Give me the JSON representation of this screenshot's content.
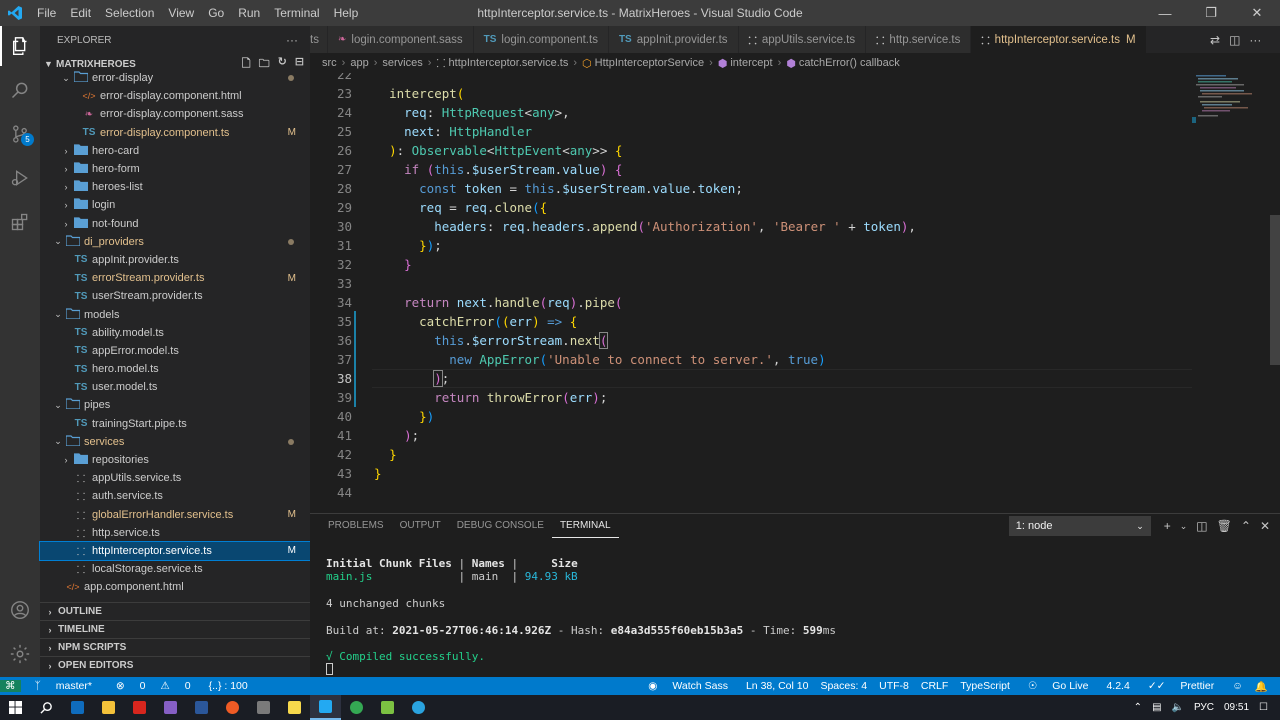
{
  "titlebar": {
    "menu": [
      "File",
      "Edit",
      "Selection",
      "View",
      "Go",
      "Run",
      "Terminal",
      "Help"
    ],
    "title": "httpInterceptor.service.ts - MatrixHeroes - Visual Studio Code"
  },
  "activitybar": {
    "scm_badge": "5"
  },
  "sidebar": {
    "header": "EXPLORER",
    "project": "MATRIXHEROES",
    "tree": [
      {
        "label": "error-display",
        "kind": "folder",
        "depth": 2,
        "open": true,
        "dot": true
      },
      {
        "label": "error-display.component.html",
        "kind": "html",
        "depth": 3
      },
      {
        "label": "error-display.component.sass",
        "kind": "sass",
        "depth": 3
      },
      {
        "label": "error-display.component.ts",
        "kind": "ts",
        "depth": 3,
        "status": "M"
      },
      {
        "label": "hero-card",
        "kind": "folder",
        "depth": 2,
        "open": false
      },
      {
        "label": "hero-form",
        "kind": "folder",
        "depth": 2,
        "open": false
      },
      {
        "label": "heroes-list",
        "kind": "folder",
        "depth": 2,
        "open": false
      },
      {
        "label": "login",
        "kind": "folder",
        "depth": 2,
        "open": false
      },
      {
        "label": "not-found",
        "kind": "folder",
        "depth": 2,
        "open": false
      },
      {
        "label": "di_providers",
        "kind": "folder",
        "depth": 1,
        "open": true,
        "dot": true,
        "mod": true
      },
      {
        "label": "appInit.provider.ts",
        "kind": "ts",
        "depth": 2
      },
      {
        "label": "errorStream.provider.ts",
        "kind": "ts",
        "depth": 2,
        "status": "M"
      },
      {
        "label": "userStream.provider.ts",
        "kind": "ts",
        "depth": 2
      },
      {
        "label": "models",
        "kind": "folder",
        "depth": 1,
        "open": true
      },
      {
        "label": "ability.model.ts",
        "kind": "ts",
        "depth": 2
      },
      {
        "label": "appError.model.ts",
        "kind": "ts",
        "depth": 2
      },
      {
        "label": "hero.model.ts",
        "kind": "ts",
        "depth": 2
      },
      {
        "label": "user.model.ts",
        "kind": "ts",
        "depth": 2
      },
      {
        "label": "pipes",
        "kind": "folder",
        "depth": 1,
        "open": true
      },
      {
        "label": "trainingStart.pipe.ts",
        "kind": "ts",
        "depth": 2
      },
      {
        "label": "services",
        "kind": "folder",
        "depth": 1,
        "open": true,
        "dot": true,
        "mod": true
      },
      {
        "label": "repositories",
        "kind": "folder",
        "depth": 2,
        "open": false
      },
      {
        "label": "appUtils.service.ts",
        "kind": "ng",
        "depth": 2
      },
      {
        "label": "auth.service.ts",
        "kind": "ng",
        "depth": 2
      },
      {
        "label": "globalErrorHandler.service.ts",
        "kind": "ng",
        "depth": 2,
        "status": "M"
      },
      {
        "label": "http.service.ts",
        "kind": "ng",
        "depth": 2
      },
      {
        "label": "httpInterceptor.service.ts",
        "kind": "ng",
        "depth": 2,
        "status": "M",
        "selected": true
      },
      {
        "label": "localStorage.service.ts",
        "kind": "ng",
        "depth": 2
      },
      {
        "label": "app.component.html",
        "kind": "html",
        "depth": 1
      }
    ],
    "sections": [
      "OUTLINE",
      "TIMELINE",
      "NPM SCRIPTS",
      "OPEN EDITORS"
    ]
  },
  "tabs": [
    {
      "label": "ts",
      "icon": "",
      "partial": true
    },
    {
      "label": "login.component.sass",
      "icon": "sass"
    },
    {
      "label": "login.component.ts",
      "icon": "TS"
    },
    {
      "label": "appInit.provider.ts",
      "icon": "TS"
    },
    {
      "label": "appUtils.service.ts",
      "icon": "ng"
    },
    {
      "label": "http.service.ts",
      "icon": "ng"
    },
    {
      "label": "httpInterceptor.service.ts",
      "icon": "ng",
      "active": true,
      "modified": "M"
    }
  ],
  "breadcrumb": [
    "src",
    "app",
    "services",
    "httpInterceptor.service.ts",
    "HttpInterceptorService",
    "intercept",
    "catchError() callback"
  ],
  "editor": {
    "current_line": 38,
    "lines": [
      {
        "n": "22",
        "html": ""
      },
      {
        "n": "23",
        "html": "  <span class='f'>intercept</span><span class='b1'>(</span>"
      },
      {
        "n": "24",
        "html": "    <span class='v'>req</span>: <span class='t'>HttpRequest</span>&lt;<span class='t'>any</span>&gt;,"
      },
      {
        "n": "25",
        "html": "    <span class='v'>next</span>: <span class='t'>HttpHandler</span>"
      },
      {
        "n": "26",
        "html": "  <span class='b1'>)</span>: <span class='t'>Observable</span>&lt;<span class='t'>HttpEvent</span>&lt;<span class='t'>any</span>&gt;&gt; <span class='b1'>{</span>"
      },
      {
        "n": "27",
        "html": "    <span class='kc'>if</span> <span class='b2'>(</span><span class='k'>this</span>.<span class='v'>$userStream</span>.<span class='v'>value</span><span class='b2'>)</span> <span class='b2'>{</span>"
      },
      {
        "n": "28",
        "html": "      <span class='k'>const</span> <span class='v'>token</span> = <span class='k'>this</span>.<span class='v'>$userStream</span>.<span class='v'>value</span>.<span class='v'>token</span>;"
      },
      {
        "n": "29",
        "html": "      <span class='v'>req</span> = <span class='v'>req</span>.<span class='f'>clone</span><span class='b3'>(</span><span class='b1'>{</span>"
      },
      {
        "n": "30",
        "html": "        <span class='v'>headers</span>: <span class='v'>req</span>.<span class='v'>headers</span>.<span class='f'>append</span><span class='b2'>(</span><span class='s'>'Authorization'</span>, <span class='s'>'Bearer '</span> + <span class='v'>token</span><span class='b2'>)</span>,"
      },
      {
        "n": "31",
        "html": "      <span class='b1'>}</span><span class='b3'>)</span>;"
      },
      {
        "n": "32",
        "html": "    <span class='b2'>}</span>"
      },
      {
        "n": "33",
        "html": ""
      },
      {
        "n": "34",
        "html": "    <span class='kc'>return</span> <span class='v'>next</span>.<span class='f'>handle</span><span class='b2'>(</span><span class='v'>req</span><span class='b2'>)</span>.<span class='f'>pipe</span><span class='b2'>(</span>"
      },
      {
        "n": "35",
        "html": "      <span class='f'>catchError</span><span class='b3'>(</span><span class='b1'>(</span><span class='v'>err</span><span class='b1'>)</span> <span class='k'>=&gt;</span> <span class='b1'>{</span>"
      },
      {
        "n": "36",
        "html": "        <span class='k'>this</span>.<span class='v'>$errorStream</span>.<span class='f'>next</span><span class='b2' style='outline:1px solid #888'>(</span>"
      },
      {
        "n": "37",
        "html": "          <span class='k'>new</span> <span class='t'>AppError</span><span class='b3'>(</span><span class='s'>'Unable to connect to server.'</span>, <span class='k'>true</span><span class='b3'>)</span>"
      },
      {
        "n": "38",
        "html": "        <span class='b2' style='outline:1px solid #888'>)</span>;"
      },
      {
        "n": "39",
        "html": "        <span class='kc'>return</span> <span class='f'>throwError</span><span class='b2'>(</span><span class='v'>err</span><span class='b2'>)</span>;"
      },
      {
        "n": "40",
        "html": "      <span class='b1'>}</span><span class='b3'>)</span>"
      },
      {
        "n": "41",
        "html": "    <span class='b2'>)</span>;"
      },
      {
        "n": "42",
        "html": "  <span class='b1'>}</span>"
      },
      {
        "n": "43",
        "html": "<span class='b1'>}</span>"
      },
      {
        "n": "44",
        "html": ""
      }
    ]
  },
  "panel": {
    "tabs": [
      "PROBLEMS",
      "OUTPUT",
      "DEBUG CONSOLE",
      "TERMINAL"
    ],
    "active_tab": "TERMINAL",
    "terminal_select": "1: node",
    "terminal": {
      "hdr_files": "Initial Chunk Files",
      "hdr_names": "Names",
      "hdr_size": "Size",
      "file": "main.js",
      "name": "main",
      "size": "94.93 kB",
      "unchanged": "4 unchanged chunks",
      "build_prefix": "Build at: ",
      "build_time": "2021-05-27T06:46:14.926Z",
      "hash_prefix": " - Hash: ",
      "hash": "e84a3d555f60eb15b3a5",
      "time_prefix": " - Time: ",
      "time": "599",
      "time_unit": "ms",
      "compiled": "√ Compiled successfully."
    }
  },
  "statusbar": {
    "branch": "master*",
    "errors": "0",
    "warnings": "0",
    "extra": "{..} : 100",
    "watch": "Watch Sass",
    "position": "Ln 38, Col 10",
    "spaces": "Spaces: 4",
    "encoding": "UTF-8",
    "eol": "CRLF",
    "language": "TypeScript",
    "golive": "Go Live",
    "version": "4.2.4",
    "prettier": "Prettier"
  },
  "taskbar": {
    "lang": "РУС",
    "time": "09:51"
  },
  "colors": {
    "accent": "#007acc",
    "modified": "#e2c08d",
    "selection": "#094771"
  }
}
